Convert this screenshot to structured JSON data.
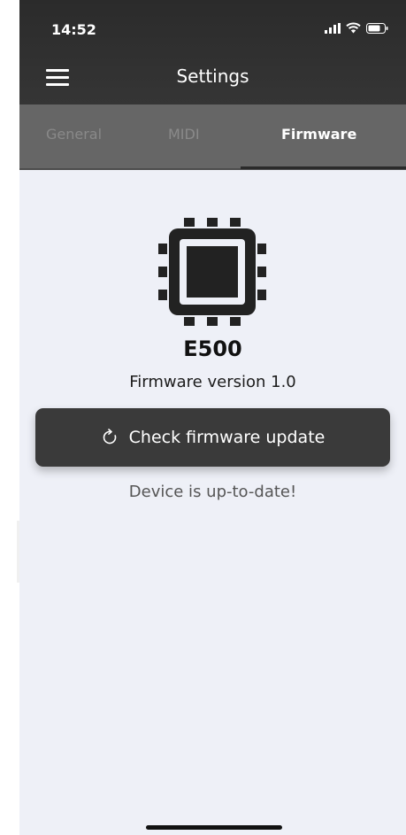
{
  "status_bar": {
    "time": "14:52",
    "icons": [
      "signal-icon",
      "wifi-icon",
      "battery-icon"
    ]
  },
  "header": {
    "title": "Settings",
    "menu_icon": "hamburger-menu-icon"
  },
  "tabs": [
    {
      "label": "General",
      "active": false
    },
    {
      "label": "MIDI",
      "active": false
    },
    {
      "label": "Firmware",
      "active": true
    }
  ],
  "firmware": {
    "chip_icon": "chip-icon",
    "device_name": "E500",
    "version_text": "Firmware version 1.0",
    "check_button_label": "Check firmware update",
    "check_button_icon": "refresh-icon",
    "status_message": "Device is up-to-date!"
  },
  "colors": {
    "header_bg": "#2b2b2b",
    "tab_bar_bg": "#666666",
    "content_bg": "#eef0f7",
    "button_bg": "#3a3a3a"
  }
}
